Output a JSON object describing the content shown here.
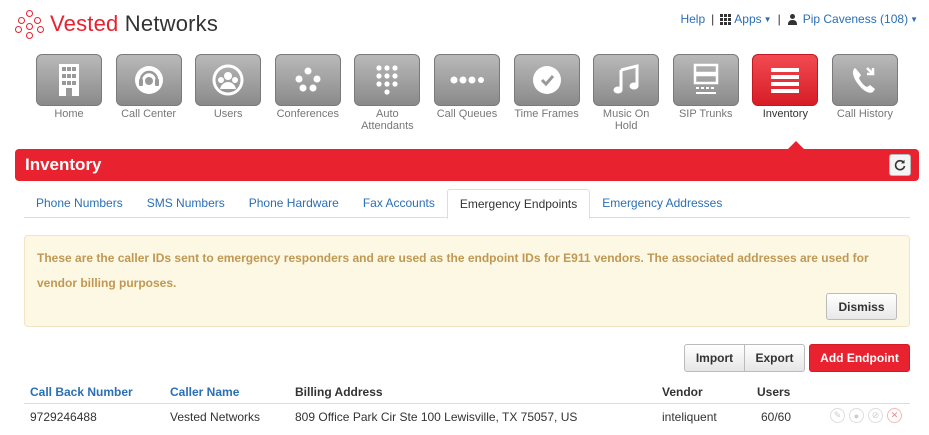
{
  "brand": {
    "name_part1": "Vested",
    "name_part2": " Networks",
    "color": "#e8222e"
  },
  "topnav": {
    "help": "Help",
    "apps": "Apps",
    "user": "Pip Caveness (108)"
  },
  "tiles": [
    {
      "label": "Home",
      "icon": "building-icon"
    },
    {
      "label": "Call Center",
      "icon": "headset-icon"
    },
    {
      "label": "Users",
      "icon": "users-icon"
    },
    {
      "label": "Conferences",
      "icon": "conference-icon"
    },
    {
      "label": "Auto Attendants",
      "icon": "keypad-icon"
    },
    {
      "label": "Call Queues",
      "icon": "dots-icon"
    },
    {
      "label": "Time Frames",
      "icon": "clock-icon"
    },
    {
      "label": "Music On Hold",
      "icon": "music-icon"
    },
    {
      "label": "SIP Trunks",
      "icon": "server-icon"
    },
    {
      "label": "Inventory",
      "icon": "list-icon"
    },
    {
      "label": "Call History",
      "icon": "phone-history-icon"
    }
  ],
  "page": {
    "title": "Inventory"
  },
  "tabs": [
    "Phone Numbers",
    "SMS Numbers",
    "Phone Hardware",
    "Fax Accounts",
    "Emergency Endpoints",
    "Emergency Addresses"
  ],
  "active_tab": "Emergency Endpoints",
  "alert": {
    "text": "These are the caller IDs sent to emergency responders and are used as the endpoint IDs for E911 vendors. The associated addresses are used for vendor billing purposes.",
    "dismiss": "Dismiss"
  },
  "actions": {
    "import": "Import",
    "export": "Export",
    "add": "Add Endpoint"
  },
  "table": {
    "headers": {
      "callback": "Call Back Number",
      "caller": "Caller Name",
      "billing": "Billing Address",
      "vendor": "Vendor",
      "users": "Users"
    },
    "rows": [
      {
        "callback": "9729246488",
        "caller": "Vested Networks",
        "billing": "809 Office Park Cir Ste 100 Lewisville, TX 75057, US",
        "vendor": "inteliquent",
        "users": "60/60"
      }
    ]
  }
}
